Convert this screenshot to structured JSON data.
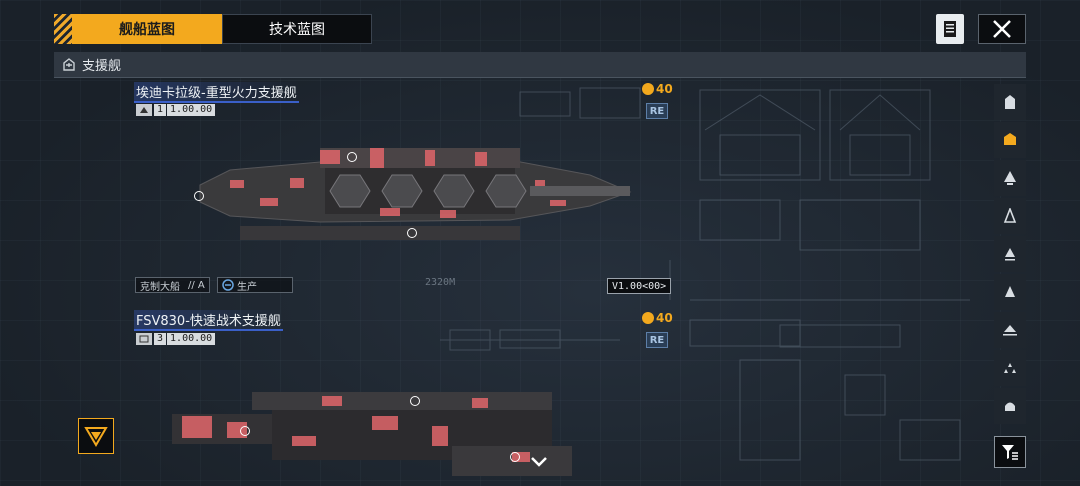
{
  "tabs": [
    {
      "label": "舰船蓝图",
      "active": true
    },
    {
      "label": "技术蓝图",
      "active": false
    }
  ],
  "category": {
    "label": "支援舰",
    "icon": "support-ship-icon"
  },
  "ships": [
    {
      "name": "埃迪卡拉级-重型火力支援舰",
      "class_number": "1",
      "count": "1.00.00",
      "cost": "40",
      "badge": "RE",
      "tag_type": "克制大船",
      "tag_suffix": "// A",
      "tag_status": "生产",
      "length_label": "2320M",
      "version": "V1.00<00>"
    },
    {
      "name": "FSV830-快速战术支援舰",
      "class_number": "3",
      "count": "1.00.00",
      "cost": "40",
      "badge": "RE"
    }
  ],
  "sidebar": {
    "items": [
      {
        "icon": "carrier-icon",
        "active": false
      },
      {
        "icon": "support-ship-icon",
        "active": true
      },
      {
        "icon": "cruiser-icon",
        "active": false
      },
      {
        "icon": "destroyer-icon",
        "active": false
      },
      {
        "icon": "frigate-icon",
        "active": false
      },
      {
        "icon": "corvette-icon",
        "active": false
      },
      {
        "icon": "aircraft-icon",
        "active": false
      },
      {
        "icon": "squadron-icon",
        "active": false
      },
      {
        "icon": "module-icon",
        "active": false
      }
    ]
  },
  "colors": {
    "accent": "#f3a91e",
    "hull": "#3a3a3c",
    "highlight": "#e0666a",
    "badge": "#5d7fa8"
  }
}
